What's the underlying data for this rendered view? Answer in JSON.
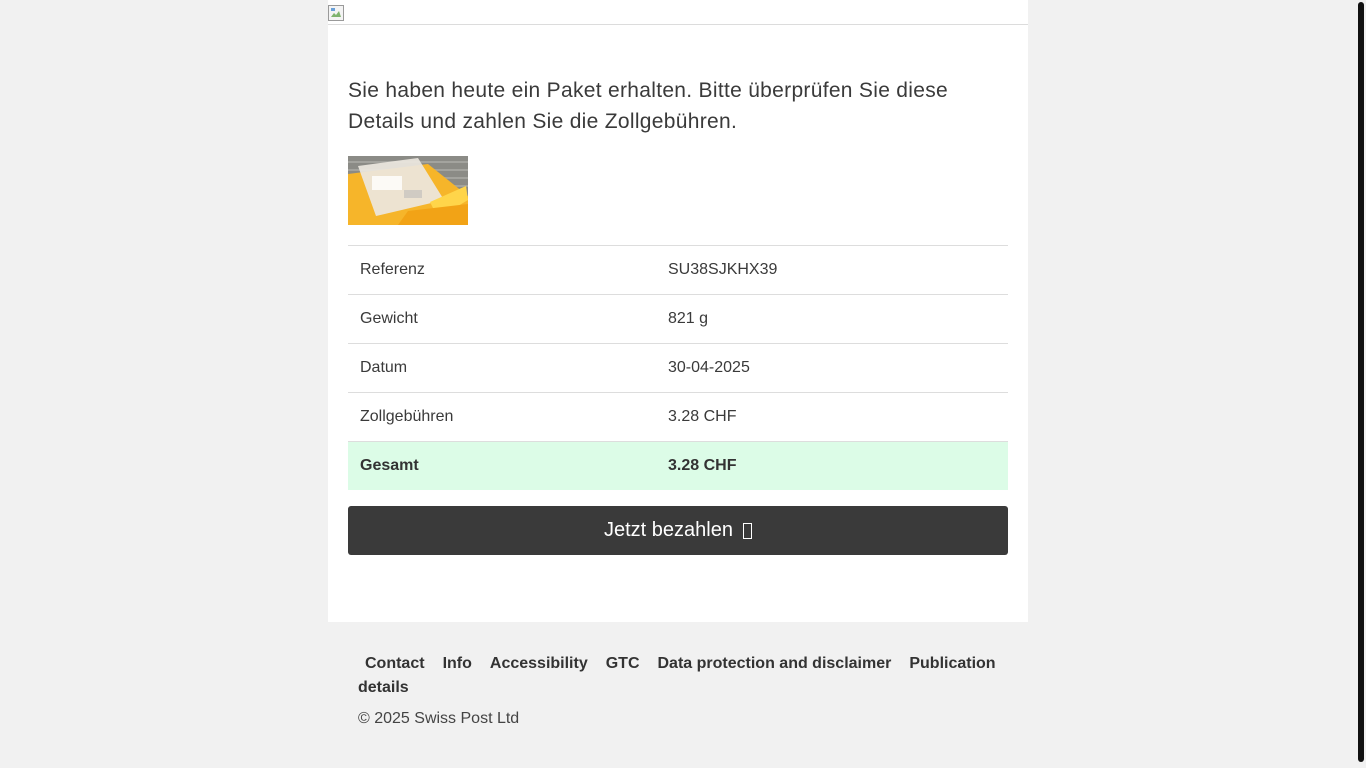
{
  "intro_text": "Sie haben heute ein Paket erhalten. Bitte überprüfen Sie diese Details und zahlen Sie die Zollgebühren.",
  "details": [
    {
      "label": "Referenz",
      "value": "SU38SJKHX39"
    },
    {
      "label": "Gewicht",
      "value": "821 g"
    },
    {
      "label": "Datum",
      "value": "30-04-2025"
    },
    {
      "label": "Zollgebühren",
      "value": "3.28 CHF"
    }
  ],
  "total": {
    "label": "Gesamt",
    "value": "3.28 CHF"
  },
  "pay_button": {
    "label": "Jetzt bezahlen",
    "icon": "missing-glyph-icon"
  },
  "footer": {
    "links": [
      "Contact",
      "Info",
      "Accessibility",
      "GTC",
      "Data protection and disclaimer",
      "Publication details"
    ],
    "copyright": "© 2025 Swiss Post Ltd"
  },
  "colors": {
    "total_row_bg": "#dcfce7",
    "button_bg": "#3a3a3a",
    "page_bg": "#f1f1f1"
  }
}
